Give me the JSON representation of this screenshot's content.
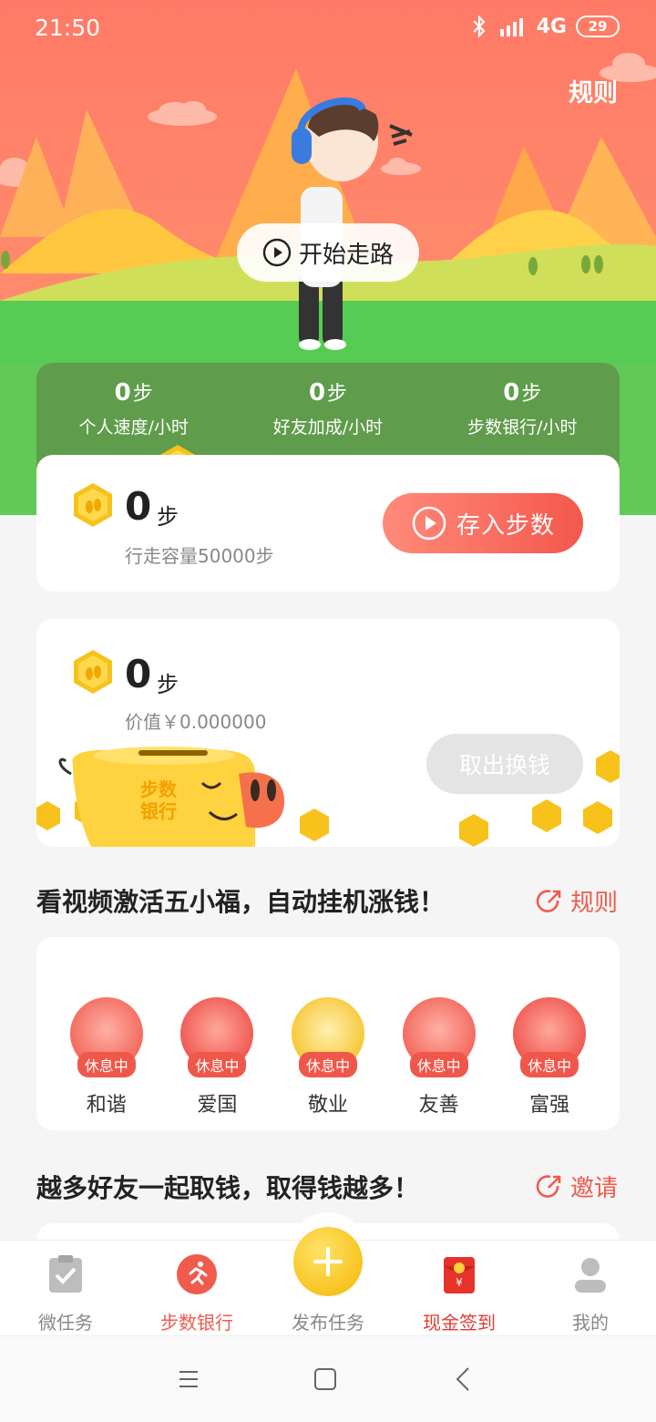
{
  "status_bar": {
    "time": "21:50",
    "network": "4G",
    "battery": "29"
  },
  "hero": {
    "rules_label": "规则",
    "start_walk_label": "开始走路"
  },
  "stats": [
    {
      "value": "0",
      "unit": "步",
      "label": "个人速度/小时"
    },
    {
      "value": "0",
      "unit": "步",
      "label": "好友加成/小时"
    },
    {
      "value": "0",
      "unit": "步",
      "label": "步数银行/小时"
    }
  ],
  "deposit": {
    "steps": "0",
    "unit": "步",
    "capacity": "行走容量50000步",
    "button": "存入步数"
  },
  "bank": {
    "steps": "0",
    "unit": "步",
    "value": "价值￥0.000000",
    "button": "取出换钱",
    "pig_text_1": "步数",
    "pig_text_2": "银行"
  },
  "fortune_section": {
    "title": "看视频激活五小福，自动挂机涨钱！",
    "link": "规则",
    "items": [
      {
        "name": "和谐",
        "status": "休息中",
        "color": "#f36a5e"
      },
      {
        "name": "爱国",
        "status": "休息中",
        "color": "#f05a53"
      },
      {
        "name": "敬业",
        "status": "休息中",
        "color": "#f8c83a"
      },
      {
        "name": "友善",
        "status": "休息中",
        "color": "#f36a5e"
      },
      {
        "name": "富强",
        "status": "休息中",
        "color": "#f05a53"
      }
    ]
  },
  "friends_section": {
    "title": "越多好友一起取钱，取得钱越多！",
    "link": "邀请"
  },
  "bottom_nav": [
    {
      "label": "微任务",
      "icon": "clipboard-check-icon"
    },
    {
      "label": "步数银行",
      "icon": "running-icon"
    },
    {
      "label": "发布任务",
      "icon": "plus-icon"
    },
    {
      "label": "现金签到",
      "icon": "red-envelope-icon"
    },
    {
      "label": "我的",
      "icon": "person-icon"
    }
  ],
  "colors": {
    "accent": "#ef5b4d",
    "coin": "#f7c21c",
    "stats_bg": "#5f9c4b"
  }
}
